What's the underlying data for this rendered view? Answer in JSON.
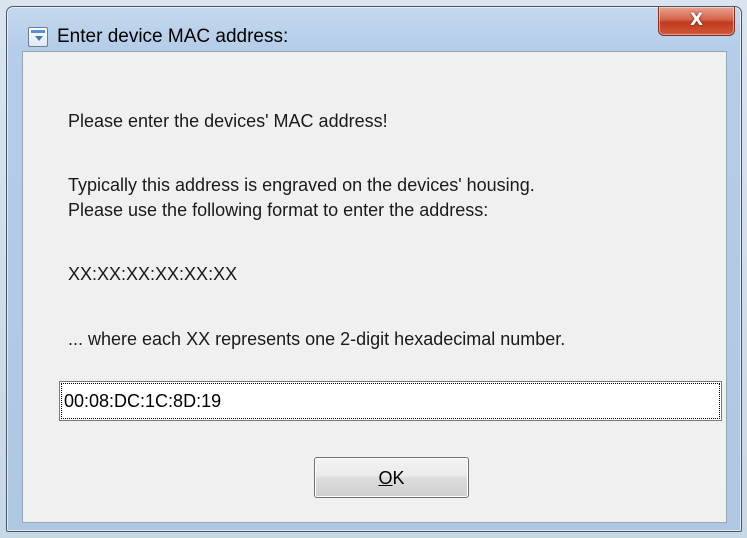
{
  "window": {
    "title": "Enter device MAC address:",
    "close_label": "X"
  },
  "dialog": {
    "line1": "Please enter the devices' MAC address!",
    "line2": "Typically this address is engraved on the devices' housing.",
    "line3": "Please use the following format to enter the address:",
    "format": "XX:XX:XX:XX:XX:XX",
    "hint": "... where each XX represents one 2-digit hexadecimal number.",
    "input_value": "00:08:DC:1C:8D:19",
    "ok_mnemonic": "O",
    "ok_rest": "K"
  },
  "icons": {
    "window_icon": "app-icon",
    "close_icon": "close-icon"
  },
  "colors": {
    "close_button": "#c8452a",
    "window_frame": "#b5cde8",
    "client_bg": "#f0f0f0"
  }
}
